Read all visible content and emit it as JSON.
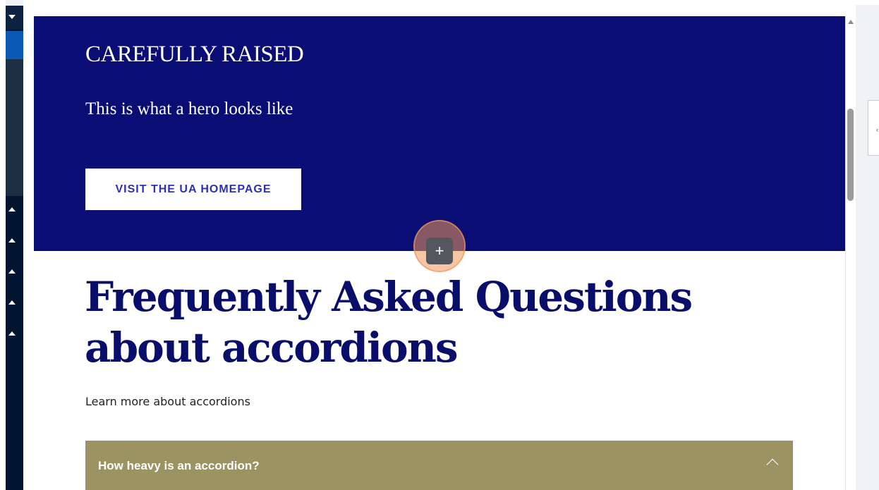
{
  "hero": {
    "brand": "CAREFULLY RAISED",
    "subtitle": "This is what a hero looks like",
    "button_label": "VISIT THE UA HOMEPAGE"
  },
  "add_block": {
    "icon_glyph": "+"
  },
  "faq": {
    "title_line1": "Frequently Asked Questions",
    "title_line2": "about accordions",
    "subtitle": "Learn more about accordions",
    "accordion_items": [
      {
        "label": "How heavy is an accordion?"
      }
    ]
  },
  "colors": {
    "hero_bg": "#0a0e74",
    "heading": "#0a0e6b",
    "accordion_bg": "#9c9362",
    "button_text": "#2b30b8",
    "sidebar": "#011533",
    "sidebar_active": "#0a5ab5"
  },
  "icons": {
    "sidebar_toggle": "caret-down-icon",
    "sidebar_collapse": "caret-up-icon",
    "add_block": "plus-icon",
    "accordion": "chevron-up-icon",
    "scroll_up": "arrow-up-icon",
    "panel_toggle": "chevron-left-icon"
  }
}
